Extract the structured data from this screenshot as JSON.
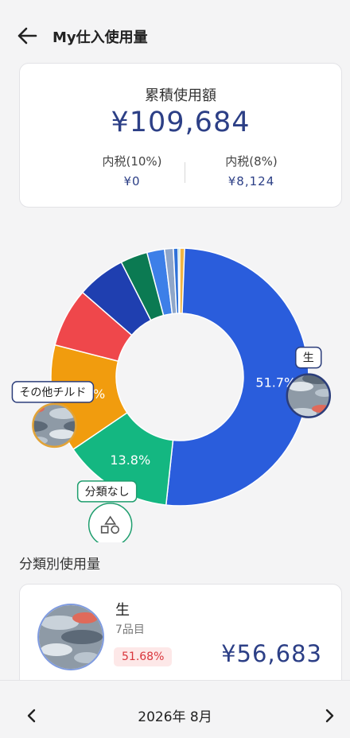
{
  "header": {
    "title": "My仕入使用量",
    "back_icon": "arrow-left-icon"
  },
  "summary": {
    "label": "累積使用額",
    "total": "¥109,684",
    "tax10_label": "内税(10%)",
    "tax10_value": "¥0",
    "tax8_label": "内税(8%)",
    "tax8_value": "¥8,124"
  },
  "chart_data": {
    "type": "pie",
    "slices": [
      {
        "label": "生",
        "percent": 51.7,
        "color": "#2a5ddc",
        "label_text": "51.7%"
      },
      {
        "label": "分類なし",
        "percent": 13.8,
        "color": "#14b781",
        "label_text": "13.8%"
      },
      {
        "label": "その他チルド",
        "percent": 13.5,
        "color": "#f19c0e",
        "label_text": "13.5%"
      },
      {
        "label": "",
        "percent": 7.4,
        "color": "#ef474b"
      },
      {
        "label": "",
        "percent": 6.1,
        "color": "#1f3fb0"
      },
      {
        "label": "",
        "percent": 3.4,
        "color": "#0b7a52"
      },
      {
        "label": "",
        "percent": 2.2,
        "color": "#3d7fe8"
      },
      {
        "label": "",
        "percent": 1.1,
        "color": "#8fa6c9"
      },
      {
        "label": "",
        "percent": 0.6,
        "color": "#2f72d8"
      },
      {
        "label": "",
        "percent": 0.2,
        "color": "#1b9c6a"
      },
      {
        "label": "",
        "percent": 0.6,
        "color": "#f1b443"
      }
    ],
    "callouts": [
      {
        "text": "生",
        "slice": 0
      },
      {
        "text": "分類なし",
        "slice": 1
      },
      {
        "text": "その他チルド",
        "slice": 2
      }
    ],
    "colors": {
      "fish_callout_border": "#2b3d7a",
      "orange_border": "#e2a337",
      "green_border": "#1f9e6e"
    }
  },
  "section": {
    "title": "分類別使用量"
  },
  "category": {
    "name": "生",
    "count": "7品目",
    "share": "51.68%",
    "amount": "¥56,683"
  },
  "footer": {
    "month": "2026年 8月",
    "prev_icon": "chevron-left-icon",
    "next_icon": "chevron-right-icon"
  },
  "colors": {
    "accent": "#2c3f86",
    "share_badge_bg": "#fde8e8",
    "share_badge_text": "#d9343b"
  }
}
